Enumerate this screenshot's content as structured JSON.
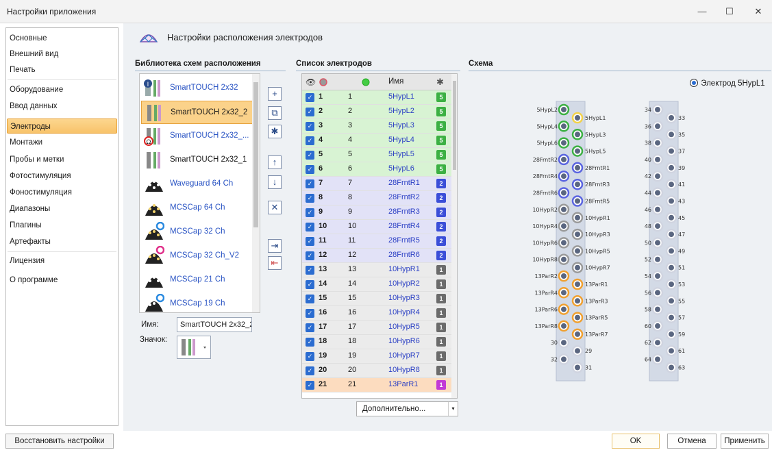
{
  "window": {
    "title": "Настройки приложения",
    "minimize": "—",
    "maximize": "☐",
    "close": "✕"
  },
  "sidebar": {
    "items": [
      {
        "label": "Основные"
      },
      {
        "label": "Внешний вид"
      },
      {
        "label": "Печать"
      },
      {
        "label": "Оборудование"
      },
      {
        "label": "Ввод данных"
      },
      {
        "label": "Электроды",
        "selected": true
      },
      {
        "label": "Монтажи"
      },
      {
        "label": "Пробы и метки"
      },
      {
        "label": "Фотостимуляция"
      },
      {
        "label": "Фоностимуляция"
      },
      {
        "label": "Диапазоны"
      },
      {
        "label": "Плагины"
      },
      {
        "label": "Артефакты"
      },
      {
        "label": "Лицензия"
      },
      {
        "label": "О программе"
      }
    ],
    "restore_label": "Восстановить настройки"
  },
  "header": {
    "title": "Настройки расположения электродов"
  },
  "library": {
    "title": "Библиотека схем расположения",
    "items": [
      {
        "label": "SmartTOUCH 2x32",
        "icon": "smarttouch-i-icon"
      },
      {
        "label": "SmartTOUCH 2x32_2",
        "icon": "smarttouch-icon",
        "selected": true
      },
      {
        "label": "SmartTOUCH  2x32_...",
        "icon": "smarttouch-omega-icon"
      },
      {
        "label": "SmartTOUCH 2x32_1",
        "icon": "smarttouch-icon"
      },
      {
        "label": "Waveguard 64 Ch",
        "icon": "cap-icon"
      },
      {
        "label": "MCSCap 64 Ch",
        "icon": "cap-icon"
      },
      {
        "label": "MCSCap 32 Ch",
        "icon": "cap-blue-dot-icon"
      },
      {
        "label": "MCSCap 32 Ch_V2",
        "icon": "cap-pink-dot-icon"
      },
      {
        "label": "MCSCap 21 Ch",
        "icon": "cap-icon"
      },
      {
        "label": "MCSCap 19 Ch",
        "icon": "cap-blue-dot-icon"
      }
    ],
    "name_label": "Имя:",
    "name_value": "SmartTOUCH 2x32_2",
    "icon_label": "Значок:",
    "tools": [
      "+",
      "⧉",
      "✱",
      "↑",
      "↓",
      "✕",
      "⇥",
      "⇤"
    ]
  },
  "electrodes": {
    "title": "Список электродов",
    "header_name": "Имя",
    "rows": [
      {
        "n": "1",
        "idx": "1",
        "name": "5HypL1",
        "grp": "5",
        "color": "#3cb043",
        "bg": "#d8f3d3"
      },
      {
        "n": "2",
        "idx": "2",
        "name": "5HypL2",
        "grp": "5",
        "color": "#3cb043",
        "bg": "#d8f3d3"
      },
      {
        "n": "3",
        "idx": "3",
        "name": "5HypL3",
        "grp": "5",
        "color": "#3cb043",
        "bg": "#d8f3d3"
      },
      {
        "n": "4",
        "idx": "4",
        "name": "5HypL4",
        "grp": "5",
        "color": "#3cb043",
        "bg": "#d8f3d3"
      },
      {
        "n": "5",
        "idx": "5",
        "name": "5HypL5",
        "grp": "5",
        "color": "#3cb043",
        "bg": "#d8f3d3"
      },
      {
        "n": "6",
        "idx": "6",
        "name": "5HypL6",
        "grp": "5",
        "color": "#3cb043",
        "bg": "#d8f3d3"
      },
      {
        "n": "7",
        "idx": "7",
        "name": "28FrntR1",
        "grp": "2",
        "color": "#3b4ed8",
        "bg": "#e2e2f7"
      },
      {
        "n": "8",
        "idx": "8",
        "name": "28FrntR2",
        "grp": "2",
        "color": "#3b4ed8",
        "bg": "#e2e2f7"
      },
      {
        "n": "9",
        "idx": "9",
        "name": "28FrntR3",
        "grp": "2",
        "color": "#3b4ed8",
        "bg": "#e2e2f7"
      },
      {
        "n": "10",
        "idx": "10",
        "name": "28FrntR4",
        "grp": "2",
        "color": "#3b4ed8",
        "bg": "#e2e2f7"
      },
      {
        "n": "11",
        "idx": "11",
        "name": "28FrntR5",
        "grp": "2",
        "color": "#3b4ed8",
        "bg": "#e2e2f7"
      },
      {
        "n": "12",
        "idx": "12",
        "name": "28FrntR6",
        "grp": "2",
        "color": "#3b4ed8",
        "bg": "#e2e2f7"
      },
      {
        "n": "13",
        "idx": "13",
        "name": "10HypR1",
        "grp": "1",
        "color": "#6b6b6b",
        "bg": "#ebebeb"
      },
      {
        "n": "14",
        "idx": "14",
        "name": "10HypR2",
        "grp": "1",
        "color": "#6b6b6b",
        "bg": "#ebebeb"
      },
      {
        "n": "15",
        "idx": "15",
        "name": "10HypR3",
        "grp": "1",
        "color": "#6b6b6b",
        "bg": "#ebebeb"
      },
      {
        "n": "16",
        "idx": "16",
        "name": "10HypR4",
        "grp": "1",
        "color": "#6b6b6b",
        "bg": "#ebebeb"
      },
      {
        "n": "17",
        "idx": "17",
        "name": "10HypR5",
        "grp": "1",
        "color": "#6b6b6b",
        "bg": "#ebebeb"
      },
      {
        "n": "18",
        "idx": "18",
        "name": "10HypR6",
        "grp": "1",
        "color": "#6b6b6b",
        "bg": "#ebebeb"
      },
      {
        "n": "19",
        "idx": "19",
        "name": "10HypR7",
        "grp": "1",
        "color": "#6b6b6b",
        "bg": "#ebebeb"
      },
      {
        "n": "20",
        "idx": "20",
        "name": "10HypR8",
        "grp": "1",
        "color": "#6b6b6b",
        "bg": "#ebebeb"
      },
      {
        "n": "21",
        "idx": "21",
        "name": "13ParR1",
        "grp": "1",
        "color": "#c23ad6",
        "bg": "#fcdcbf"
      }
    ],
    "more_label": "Дополнительно..."
  },
  "schema": {
    "title": "Схема",
    "selected_label": "Электрод 5HypL1",
    "left_block": {
      "left_labels": [
        "5HypL2",
        "5HypL4",
        "5HypL6",
        "28FrntR2",
        "28FrntR4",
        "28FrntR6",
        "10HypR2",
        "10HypR4",
        "10HypR6",
        "10HypR8",
        "13ParR2",
        "13ParR4",
        "13ParR6",
        "13ParR8",
        "30",
        "32"
      ],
      "right_labels": [
        "5HypL1",
        "5HypL3",
        "5HypL5",
        "28FrntR1",
        "28FrntR3",
        "28FrntR5",
        "10HypR1",
        "10HypR3",
        "10HypR5",
        "10HypR7",
        "13ParR1",
        "13ParR3",
        "13ParR5",
        "13ParR7",
        "29",
        "31"
      ],
      "ring_colors": [
        "#3cb043",
        "#3cb043",
        "#3cb043",
        "#5a64e0",
        "#5a64e0",
        "#5a64e0",
        "#9a9a9a",
        "#9a9a9a",
        "#9a9a9a",
        "#9a9a9a",
        "#f0a030",
        "#f0a030",
        "#f0a030",
        "#f0a030",
        "#d0d4e0",
        "#d0d4e0"
      ]
    },
    "right_block": {
      "left_labels": [
        "34",
        "36",
        "38",
        "40",
        "42",
        "44",
        "46",
        "48",
        "50",
        "52",
        "54",
        "56",
        "58",
        "60",
        "62",
        "64"
      ],
      "right_labels": [
        "33",
        "35",
        "37",
        "39",
        "41",
        "43",
        "45",
        "47",
        "49",
        "51",
        "53",
        "55",
        "57",
        "59",
        "61",
        "63"
      ]
    }
  },
  "buttons": {
    "ok": "OK",
    "cancel": "Отмена",
    "apply": "Применить"
  }
}
